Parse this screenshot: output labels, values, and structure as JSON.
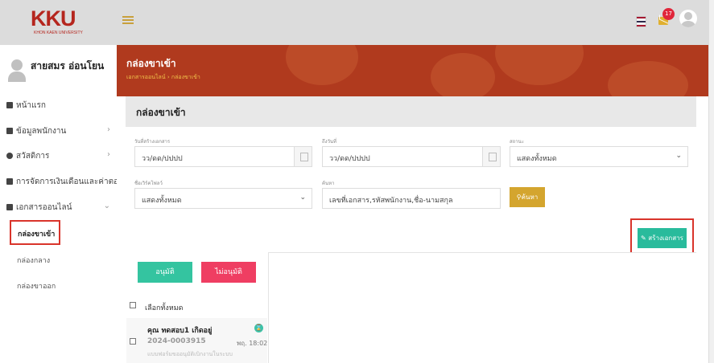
{
  "header": {
    "logo_text": "KKU",
    "logo_sub": "KHON KAEN UNIVERSITY",
    "notification_count": "17"
  },
  "sidebar": {
    "user_name": "สายสมร อ่อนโยน",
    "items": [
      {
        "label": "หน้าแรก"
      },
      {
        "label": "ข้อมูลพนักงาน"
      },
      {
        "label": "สวัสดิการ"
      },
      {
        "label": "การจัดการเงินเดือนและค่าตอบแทน"
      },
      {
        "label": "เอกสารออนไลน์"
      }
    ],
    "sub_items": [
      {
        "label": "กล่องขาเข้า"
      },
      {
        "label": "กล่องกลาง"
      },
      {
        "label": "กล่องขาออก"
      }
    ]
  },
  "banner": {
    "title": "กล่องขาเข้า",
    "breadcrumb_parent": "เอกสารออนไลน์",
    "breadcrumb_current": "กล่องขาเข้า"
  },
  "card": {
    "title": "กล่องขาเข้า"
  },
  "filters": {
    "date_from_label": "วันที่สร้างเอกสาร",
    "date_from_placeholder": "วว/ดด/ปปปป",
    "date_to_label": "ถึงวันที่",
    "date_to_placeholder": "วว/ดด/ปปปป",
    "status_label": "สถานะ",
    "status_value": "แสดงทั้งหมด",
    "template_label": "ชื่อเวิร์คโฟลว์",
    "template_value": "แสดงทั้งหมด",
    "search_label": "ค้นหา",
    "search_placeholder": "เลขที่เอกสาร,รหัสพนักงาน,ชื่อ-นามสกุล",
    "search_button": "ค้นหา"
  },
  "actions": {
    "create_button": "สร้างเอกสาร",
    "approve_button": "อนุมัติ",
    "reject_button": "ไม่อนุมัติ",
    "select_all": "เลือกทั้งหมด"
  },
  "documents": [
    {
      "name": "คุณ ทดสอบ1 เกิดอยู่",
      "number": "2024-0003915",
      "date": "พฤ. 18:02",
      "subject": "แบบฟอร์มขออนุมัติเบิกงานในระบบ"
    }
  ],
  "colors": {
    "banner": "#b03a1e",
    "accent_gold": "#d4a52e",
    "create_green": "#29bb9c",
    "approve_green": "#34c4a0",
    "reject_red": "#ef3e62",
    "highlight_red": "#d9342b"
  }
}
